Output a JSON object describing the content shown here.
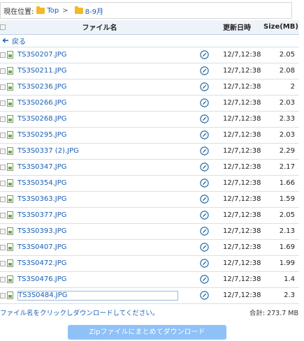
{
  "breadcrumb": {
    "label": "現在位置:",
    "items": [
      "Top",
      "8-9月"
    ],
    "separator": ">"
  },
  "table": {
    "headers": {
      "name": "ファイル名",
      "date": "更新日時",
      "size": "Size(MB)"
    },
    "back_label": "戻る",
    "rows": [
      {
        "name": "TS3S0207.JPG",
        "date": "12/7,12:38",
        "size": "2.05"
      },
      {
        "name": "TS3S0211.JPG",
        "date": "12/7,12:38",
        "size": "2.08"
      },
      {
        "name": "TS3S0236.JPG",
        "date": "12/7,12:38",
        "size": "2"
      },
      {
        "name": "TS3S0266.JPG",
        "date": "12/7,12:38",
        "size": "2.03"
      },
      {
        "name": "TS3S0268.JPG",
        "date": "12/7,12:38",
        "size": "2.33"
      },
      {
        "name": "TS3S0295.JPG",
        "date": "12/7,12:38",
        "size": "2.03"
      },
      {
        "name": "TS3S0337 (2).JPG",
        "date": "12/7,12:38",
        "size": "2.29"
      },
      {
        "name": "TS3S0347.JPG",
        "date": "12/7,12:38",
        "size": "2.17"
      },
      {
        "name": "TS3S0354.JPG",
        "date": "12/7,12:38",
        "size": "1.66"
      },
      {
        "name": "TS3S0363.JPG",
        "date": "12/7,12:38",
        "size": "1.59"
      },
      {
        "name": "TS3S0377.JPG",
        "date": "12/7,12:38",
        "size": "2.05"
      },
      {
        "name": "TS3S0393.JPG",
        "date": "12/7,12:38",
        "size": "2.13"
      },
      {
        "name": "TS3S0407.JPG",
        "date": "12/7,12:38",
        "size": "1.69"
      },
      {
        "name": "TS3S0472.JPG",
        "date": "12/7,12:38",
        "size": "1.99"
      },
      {
        "name": "TS3S0476.JPG",
        "date": "12/7,12:38",
        "size": "1.4"
      },
      {
        "name": "TS3S0484.JPG",
        "date": "12/7,12:38",
        "size": "2.3"
      }
    ]
  },
  "footer": {
    "hint": "ファイル名をクリックしダウンロードしてください。",
    "total": "合計: 273.7 MB",
    "zip_button": "Zipファイルにまとめてダウンロード"
  },
  "colors": {
    "link": "#1a5fb4",
    "header_bg": "#eef3fa",
    "button_bg": "#8ec1f7",
    "folder": "#f3b927"
  },
  "icons": {
    "file": "image-file-icon",
    "edit": "edit-icon",
    "back": "back-arrow-icon",
    "folder": "folder-icon"
  }
}
